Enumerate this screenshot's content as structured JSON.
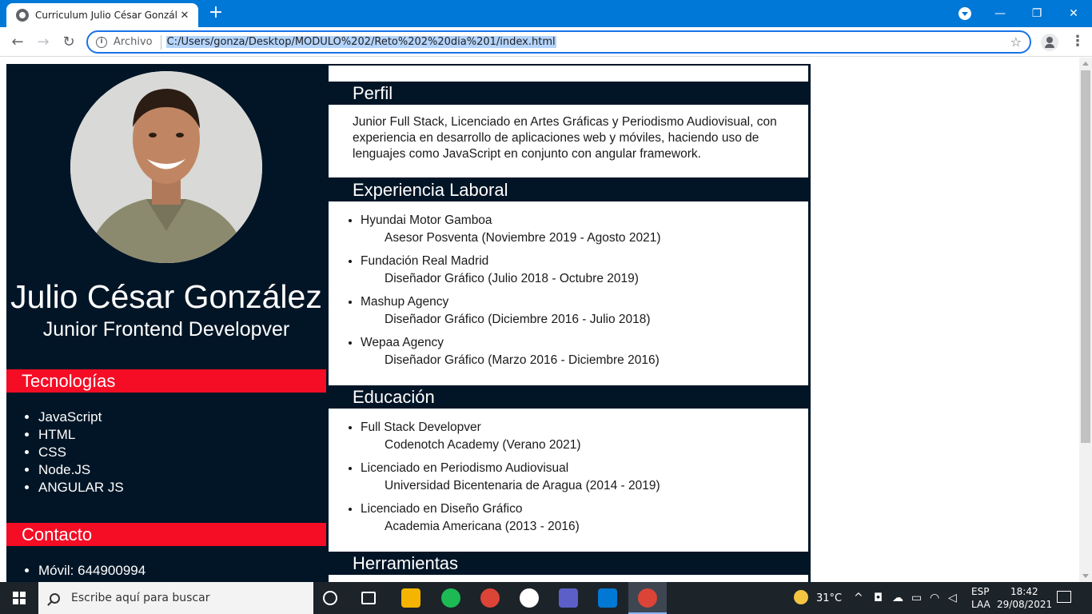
{
  "browser": {
    "tab_title": "Curriculum Julio César González",
    "tab_close": "✕",
    "new_tab": "+",
    "minimize": "—",
    "restore": "❐",
    "close": "✕",
    "back": "←",
    "forward": "→",
    "reload": "↻",
    "info": "i",
    "archivo_label": "Archivo",
    "url": "C:/Users/gonza/Desktop/MODULO%202/Reto%202%20dia%201/index.html",
    "star": "☆",
    "menu": "⋮"
  },
  "cv": {
    "name": "Julio César González",
    "role": "Junior Frontend Developver",
    "tecnologias": {
      "title": "Tecnologías",
      "items": [
        "JavaScript",
        "HTML",
        "CSS",
        "Node.JS",
        "ANGULAR JS"
      ]
    },
    "contacto": {
      "title": "Contacto",
      "items": [
        "Móvil: 644900994"
      ]
    },
    "perfil": {
      "title": "Perfil",
      "text": "Junior Full Stack, Licenciado en Artes Gráficas y Periodismo Audiovisual, con experiencia en desarrollo de aplicaciones web y móviles, haciendo uso de lenguajes como JavaScript en conjunto con angular framework."
    },
    "experiencia": {
      "title": "Experiencia Laboral",
      "items": [
        {
          "company": "Hyundai Motor Gamboa",
          "detail": "Asesor Posventa (Noviembre 2019 - Agosto 2021)"
        },
        {
          "company": "Fundación Real Madrid",
          "detail": "Diseñador Gráfico (Julio 2018 - Octubre 2019)"
        },
        {
          "company": "Mashup Agency",
          "detail": "Diseñador Gráfico (Diciembre 2016 - Julio 2018)"
        },
        {
          "company": "Wepaa Agency",
          "detail": "Diseñador Gráfico (Marzo 2016 - Diciembre 2016)"
        }
      ]
    },
    "educacion": {
      "title": "Educación",
      "items": [
        {
          "degree": "Full Stack Developver",
          "detail": "Codenotch Academy (Verano 2021)"
        },
        {
          "degree": "Licenciado en Periodismo Audiovisual",
          "detail": "Universidad Bicentenaria de Aragua (2014 - 2019)"
        },
        {
          "degree": "Licenciado en Diseño Gráfico",
          "detail": "Academia Americana (2013 - 2016)"
        }
      ]
    },
    "herramientas": {
      "title": "Herramientas"
    }
  },
  "taskbar": {
    "search_placeholder": "Escribe aquí para buscar",
    "weather": "31°C",
    "lang_top": "ESP",
    "lang_bottom": "LAA",
    "time": "18:42",
    "date": "29/08/2021"
  },
  "colors": {
    "titlebar": "#0078d7",
    "cv_dark": "#021526",
    "cv_accent": "#f50c25"
  }
}
